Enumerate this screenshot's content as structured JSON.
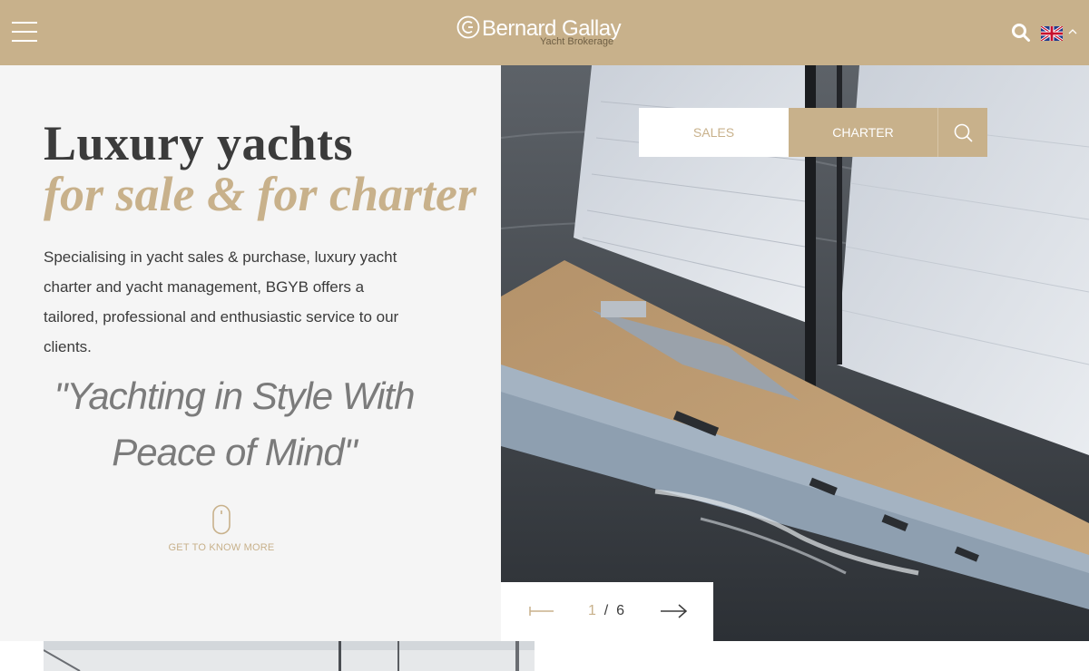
{
  "header": {
    "logo_name": "Bernard Gallay",
    "logo_sub": "Yacht Brokerage"
  },
  "hero": {
    "title_line1": "Luxury yachts",
    "title_line2": "for sale & for charter",
    "intro": "Specialising in yacht sales & purchase, luxury yacht charter and yacht management, BGYB offers a tailored, professional and enthusiastic service to our clients.",
    "quote_line1": "\"Yachting in Style With",
    "quote_line2": "Peace of Mind\"",
    "scroll_label": "GET TO KNOW MORE"
  },
  "search_tabs": {
    "sales": "SALES",
    "charter": "CHARTER",
    "active": "sales"
  },
  "slider": {
    "current": "1",
    "separator": "/",
    "total": "6"
  },
  "colors": {
    "accent": "#c8b18b",
    "text": "#3b3b3b",
    "quote": "#7b7b7b",
    "background": "#f5f5f5"
  },
  "icons": {
    "menu": "hamburger-menu-icon",
    "search": "search-icon",
    "language": "uk-flag-icon",
    "language_toggle": "chevron-up-icon",
    "scroll": "mouse-scroll-icon",
    "prev": "arrow-left-icon",
    "next": "arrow-right-icon"
  }
}
